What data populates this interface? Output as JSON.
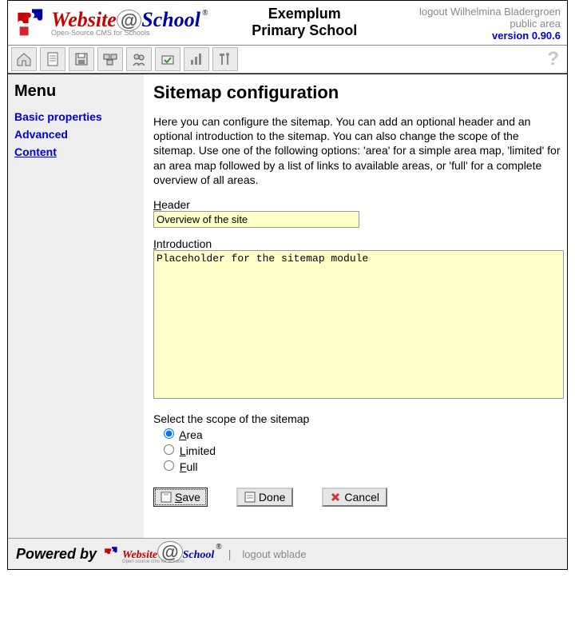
{
  "header": {
    "school_line1": "Exemplum",
    "school_line2": "Primary School",
    "logout_text": "logout Wilhelmina Bladergroen",
    "public_area": "public area",
    "version": "version 0.90.6",
    "logo_tagline": "Open-Source CMS for Schools"
  },
  "sidebar": {
    "title": "Menu",
    "items": [
      {
        "label": "Basic properties",
        "active": false
      },
      {
        "label": "Advanced",
        "active": false
      },
      {
        "label": "Content",
        "active": true
      }
    ]
  },
  "main": {
    "title": "Sitemap configuration",
    "intro": "Here you can configure the sitemap. You can add an optional header and an optional introduction to the sitemap. You can also change the scope of the sitemap. Use one of the following options: 'area' for a simple area map, 'limited' for an area map followed by a list of links to available areas, or 'full' for a complete overview of all areas.",
    "header_label_pre": "H",
    "header_label_rest": "eader",
    "header_value": "Overview of the site",
    "intro_label_pre": "I",
    "intro_label_rest": "ntroduction",
    "intro_value": "Placeholder for the sitemap module",
    "scope_label": "Select the scope of the sitemap",
    "scope_options": [
      {
        "pre": "A",
        "rest": "rea",
        "checked": true
      },
      {
        "pre": "L",
        "rest": "imited",
        "checked": false
      },
      {
        "pre": "F",
        "rest": "ull",
        "checked": false
      }
    ],
    "buttons": {
      "save_pre": "S",
      "save_rest": "ave",
      "done_label": "Done",
      "cancel_label": "Cancel"
    }
  },
  "footer": {
    "powered_by": "Powered by",
    "logout_text": "logout wblade",
    "logo_tagline": "Open source cms for schools"
  }
}
